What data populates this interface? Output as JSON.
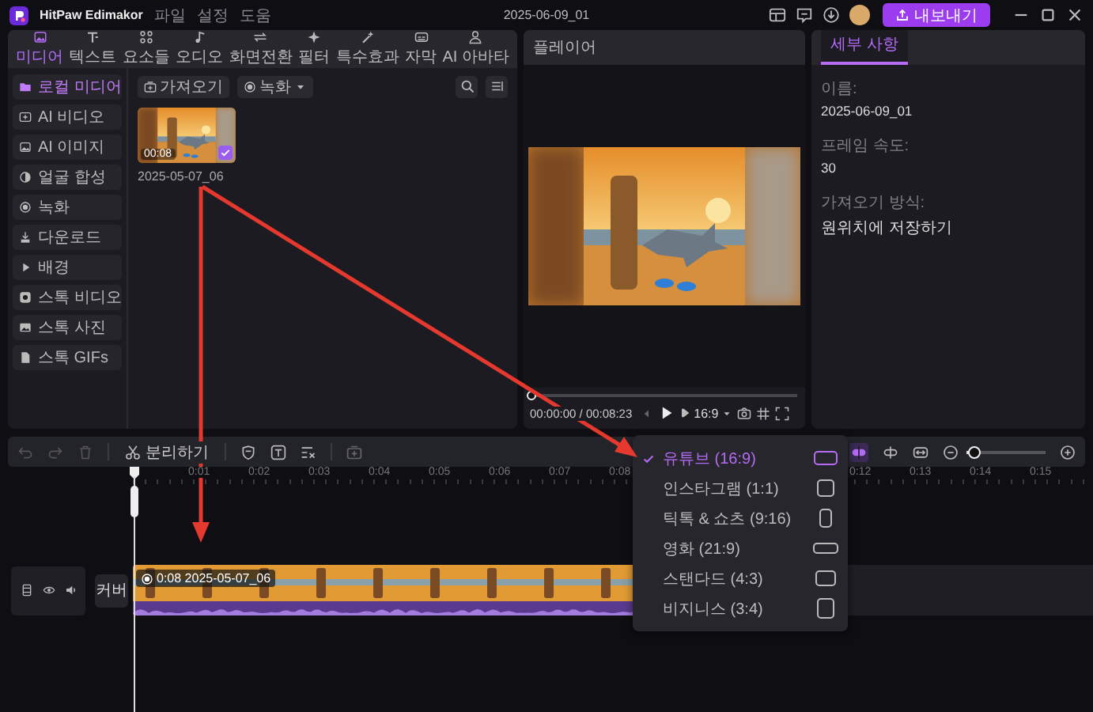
{
  "titlebar": {
    "app_name": "HitPaw Edimakor",
    "menu": [
      "파일",
      "설정",
      "도움"
    ],
    "project_title": "2025-06-09_01",
    "export_button": "내보내기"
  },
  "media_tabs": [
    {
      "label": "미디어",
      "selected": true
    },
    {
      "label": "텍스트",
      "selected": false
    },
    {
      "label": "요소들",
      "selected": false
    },
    {
      "label": "오디오",
      "selected": false
    },
    {
      "label": "화면전환",
      "selected": false
    },
    {
      "label": "필터",
      "selected": false
    },
    {
      "label": "특수효과",
      "selected": false
    },
    {
      "label": "자막",
      "selected": false
    },
    {
      "label": "AI 아바타",
      "selected": false
    }
  ],
  "sidebar": {
    "items": [
      {
        "label": "로컬 미디어",
        "selected": true
      },
      {
        "label": "AI 비디오",
        "selected": false
      },
      {
        "label": "AI 이미지",
        "selected": false
      },
      {
        "label": "얼굴 합성",
        "selected": false
      },
      {
        "label": "녹화",
        "selected": false
      },
      {
        "label": "다운로드",
        "selected": false
      },
      {
        "label": "배경",
        "selected": false
      },
      {
        "label": "스톡 비디오",
        "selected": false
      },
      {
        "label": "스톡 사진",
        "selected": false
      },
      {
        "label": "스톡 GIFs",
        "selected": false
      }
    ]
  },
  "media_toolbar": {
    "import_button": "가져오기",
    "record_button": "녹화"
  },
  "media_items": [
    {
      "duration": "00:08",
      "name": "2025-05-07_06",
      "checked": true
    }
  ],
  "player": {
    "title": "플레이어",
    "progress": {
      "level": 0
    },
    "time": "00:00:00 / 00:08:23",
    "aspect_button": "16:9"
  },
  "details": {
    "tab": "세부 사항",
    "fields": [
      {
        "label": "이름:",
        "value": "2025-06-09_01"
      },
      {
        "label": "프레임 속도:",
        "value": "30"
      },
      {
        "label": "가져오기 방식:",
        "value": "원위치에 저장하기"
      }
    ]
  },
  "timeline": {
    "split_button": "분리하기",
    "zoom": {
      "level": 0.1
    },
    "ruler_left": [
      "0:01",
      "0:02",
      "0:03",
      "0:04",
      "0:05",
      "0:06",
      "0:07",
      "0:08"
    ],
    "ruler_right": [
      "0:12",
      "0:13",
      "0:14",
      "0:15"
    ],
    "tracks": [
      {
        "cover_button": "커버",
        "clip": {
          "duration": "0:08",
          "name": "2025-05-07_06"
        }
      }
    ]
  },
  "aspect_menu": {
    "items": [
      {
        "label": "유튜브 (16:9)",
        "selected": true,
        "kind": "wide"
      },
      {
        "label": "인스타그램 (1:1)",
        "selected": false,
        "kind": "square"
      },
      {
        "label": "틱톡 & 쇼츠 (9:16)",
        "selected": false,
        "kind": "tall"
      },
      {
        "label": "영화 (21:9)",
        "selected": false,
        "kind": "cinema"
      },
      {
        "label": "스탠다드 (4:3)",
        "selected": false,
        "kind": "standard"
      },
      {
        "label": "비지니스 (3:4)",
        "selected": false,
        "kind": "portrait"
      }
    ]
  }
}
